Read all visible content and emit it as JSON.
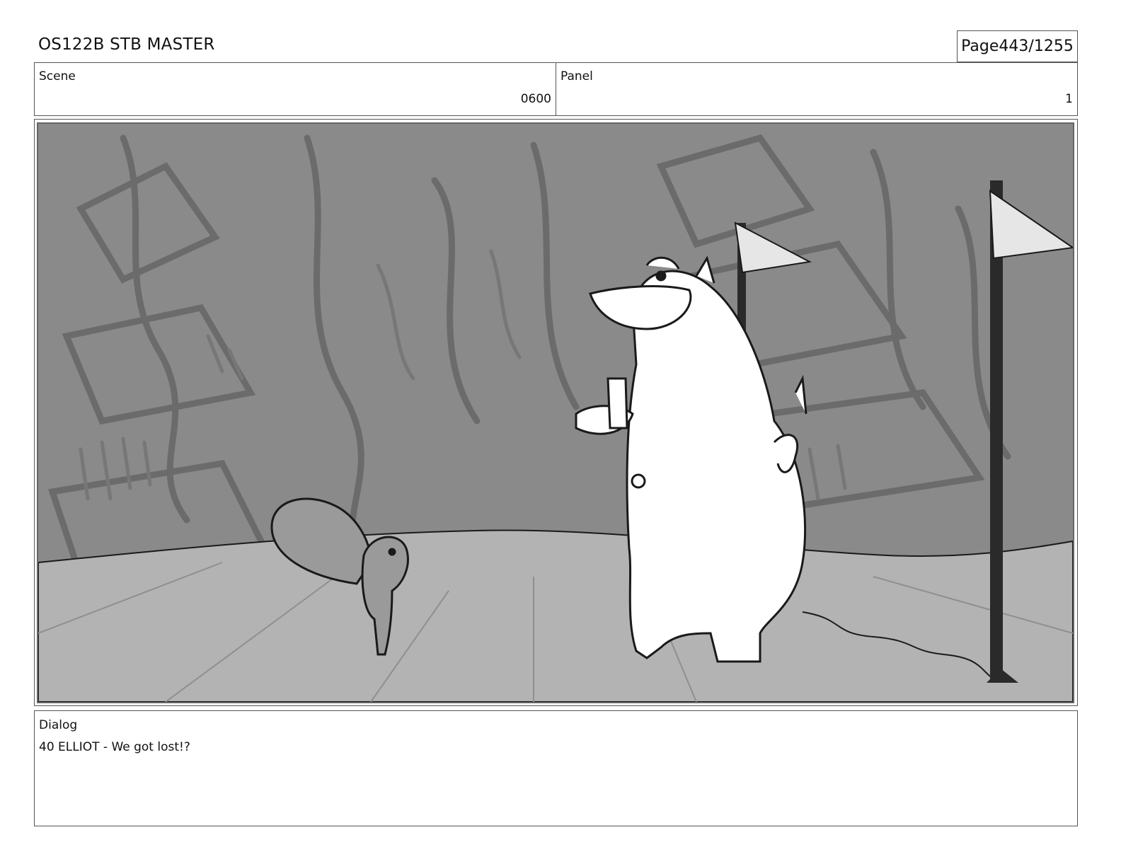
{
  "header": {
    "title": "OS122B STB MASTER",
    "page_label": "Page",
    "page_value": "443/1255"
  },
  "scene": {
    "label": "Scene",
    "value": "0600"
  },
  "panel": {
    "label": "Panel",
    "value": "1"
  },
  "dialog": {
    "label": "Dialog",
    "text": "40 ELLIOT - We got lost!?"
  },
  "colors": {
    "sky_gray": "#8a8a8a",
    "ground_gray": "#b3b3b3",
    "tree_stroke": "#6e6e6e",
    "line_ink": "#1a1a1a"
  }
}
